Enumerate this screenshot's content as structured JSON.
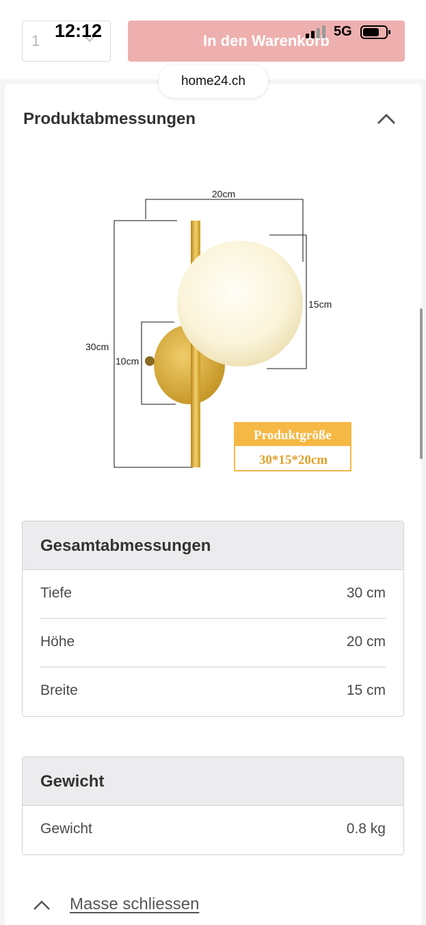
{
  "status_bar": {
    "time": "12:12",
    "network": "5G"
  },
  "browser": {
    "url": "home24.ch"
  },
  "purchase_bar": {
    "quantity": "1",
    "cart_button": "In den Warenkorb"
  },
  "product_dimensions": {
    "title": "Produktabmessungen",
    "diagram": {
      "width_label": "20cm",
      "height_label": "30cm",
      "globe_label": "15cm",
      "base_label": "10cm",
      "badge_title": "Produktgröße",
      "badge_value": "30*15*20cm"
    }
  },
  "overall_dimensions": {
    "title": "Gesamtabmessungen",
    "rows": [
      {
        "label": "Tiefe",
        "value": "30 cm"
      },
      {
        "label": "Höhe",
        "value": "20 cm"
      },
      {
        "label": "Breite",
        "value": "15 cm"
      }
    ]
  },
  "weight": {
    "title": "Gewicht",
    "rows": [
      {
        "label": "Gewicht",
        "value": "0.8 kg"
      }
    ]
  },
  "close_link": "Masse schliessen",
  "colors": {
    "cart_button": "#eeb0ae",
    "gold": "#d9a92c",
    "badge": "#f6b845"
  }
}
